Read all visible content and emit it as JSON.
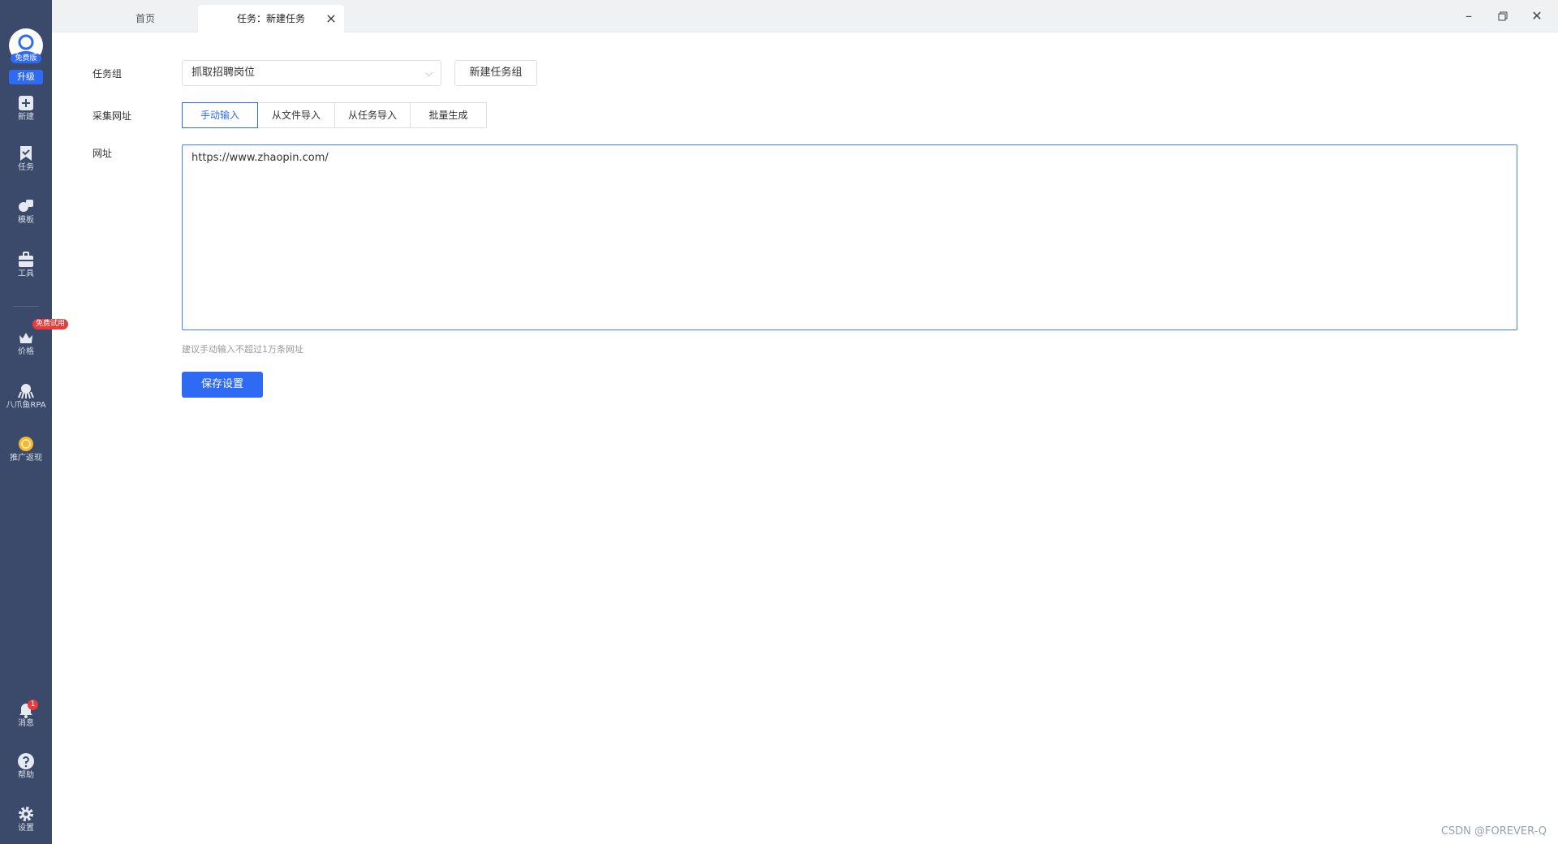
{
  "sidebar": {
    "avatar_badge": "免费版",
    "upgrade_label": "升级",
    "items": [
      {
        "label": "新建",
        "icon": "plus-square-icon"
      },
      {
        "label": "任务",
        "icon": "bookmark-icon"
      },
      {
        "label": "模板",
        "icon": "template-icon"
      },
      {
        "label": "工具",
        "icon": "toolbox-icon"
      },
      {
        "label": "价格",
        "icon": "crown-icon"
      },
      {
        "label": "八爪鱼RPA",
        "icon": "octopus-icon"
      },
      {
        "label": "推广返现",
        "icon": "coin-icon"
      },
      {
        "label": "消息",
        "icon": "bell-icon"
      },
      {
        "label": "帮助",
        "icon": "help-icon"
      },
      {
        "label": "设置",
        "icon": "gear-icon"
      }
    ],
    "trial_badge": "免费试用",
    "message_count": "1"
  },
  "tabs": {
    "home": "首页",
    "active": "任务：新建任务"
  },
  "form": {
    "task_group_label": "任务组",
    "task_group_value": "抓取招聘岗位",
    "new_group_button": "新建任务组",
    "collect_url_label": "采集网址",
    "url_modes": [
      "手动输入",
      "从文件导入",
      "从任务导入",
      "批量生成"
    ],
    "url_label": "网址",
    "url_value": "https://www.zhaopin.com/",
    "hint": "建议手动输入不超过1万条网址",
    "save_button": "保存设置"
  },
  "watermark": "CSDN @FOREVER-Q",
  "colors": {
    "sidebar_bg": "#3b4a6b",
    "accent": "#2f6af5",
    "badge_red": "#e83b3b"
  }
}
